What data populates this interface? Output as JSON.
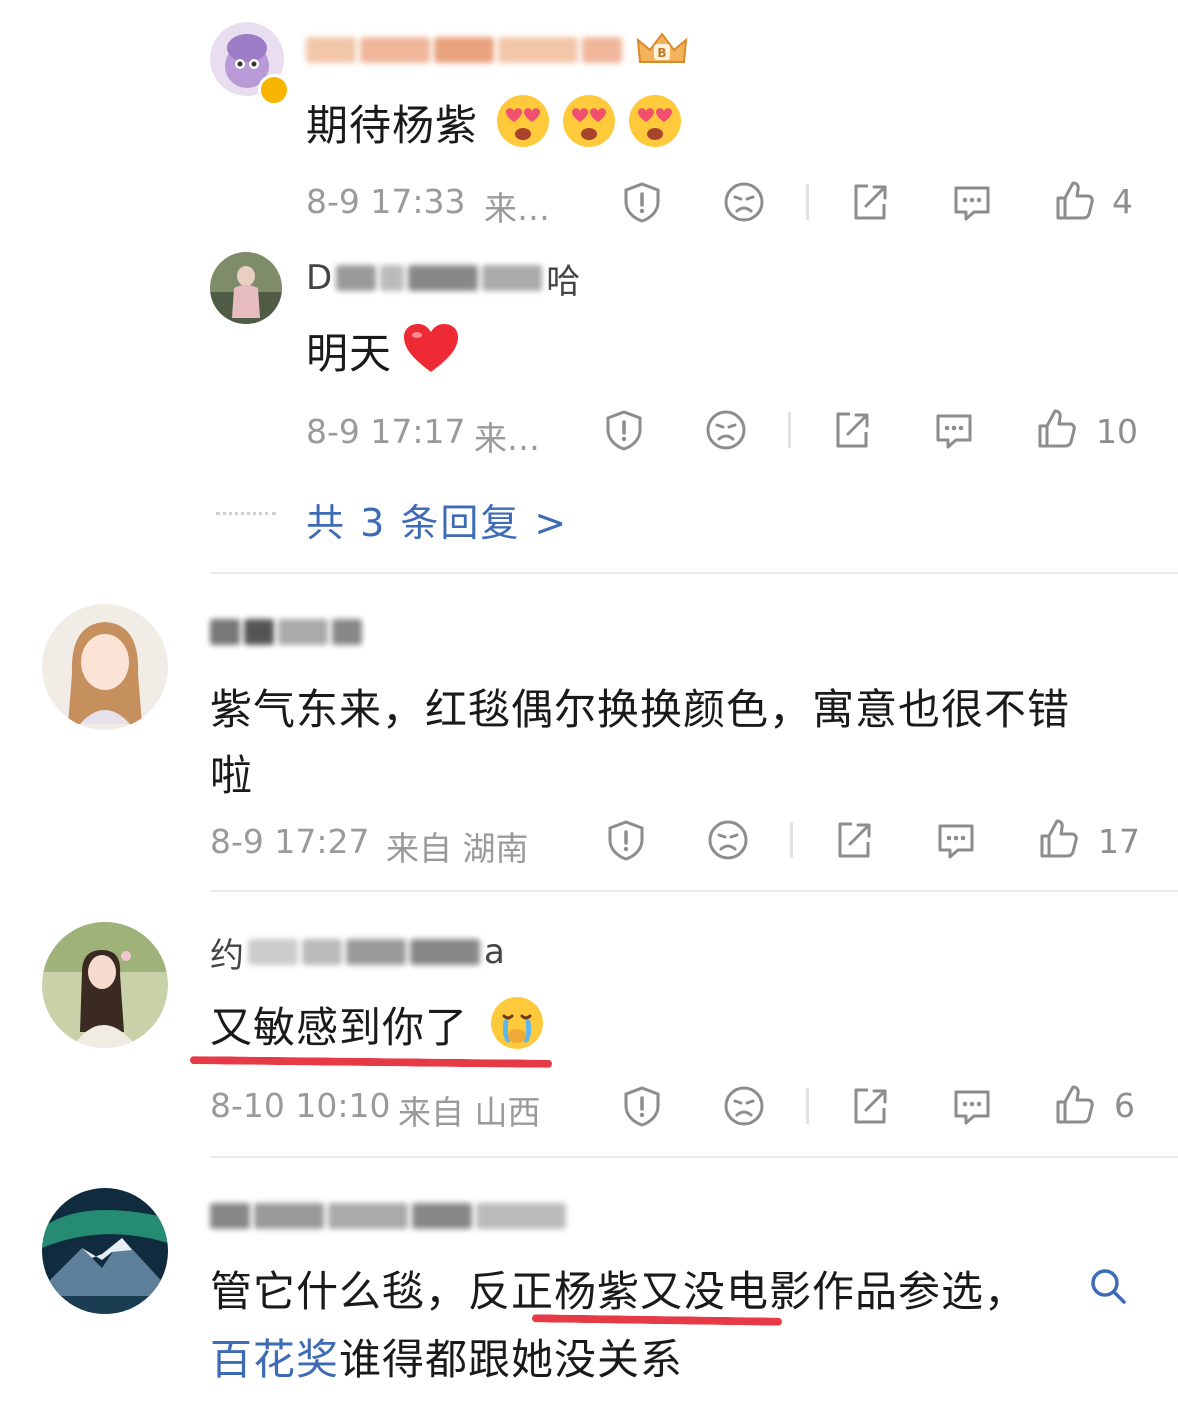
{
  "replies": [
    {
      "name": "",
      "text": "期待杨紫",
      "time": "8-9 17:33",
      "source": "来…",
      "likes": "4",
      "emojis": [
        "heart-eyes-emoji",
        "heart-eyes-emoji",
        "heart-eyes-emoji"
      ]
    },
    {
      "name": "",
      "text": "明天",
      "time": "8-9 17:17",
      "source": "来…",
      "likes": "10",
      "emojis": [
        "red-heart-emoji"
      ]
    }
  ],
  "more_replies": "共 3 条回复 >",
  "comments": [
    {
      "name": "",
      "text_line1": "紫气东来，红毯偶尔换换颜色，寓意也很不错",
      "text_line2": "啦",
      "time": "8-9 17:27",
      "source": "来自 湖南",
      "likes": "17"
    },
    {
      "name": "",
      "text": "又敏感到你了",
      "time": "8-10 10:10",
      "source": "来自 山西",
      "likes": "6"
    },
    {
      "name": "",
      "text_line1": "管它什么毯，反正杨紫又没电影作品参选，",
      "link": "百花奖",
      "text_line2_rest": "谁得都跟她没关系"
    }
  ],
  "colors": {
    "link": "#3e6bb5",
    "highlight": "#e63b47",
    "meta": "#9a9a9a"
  }
}
